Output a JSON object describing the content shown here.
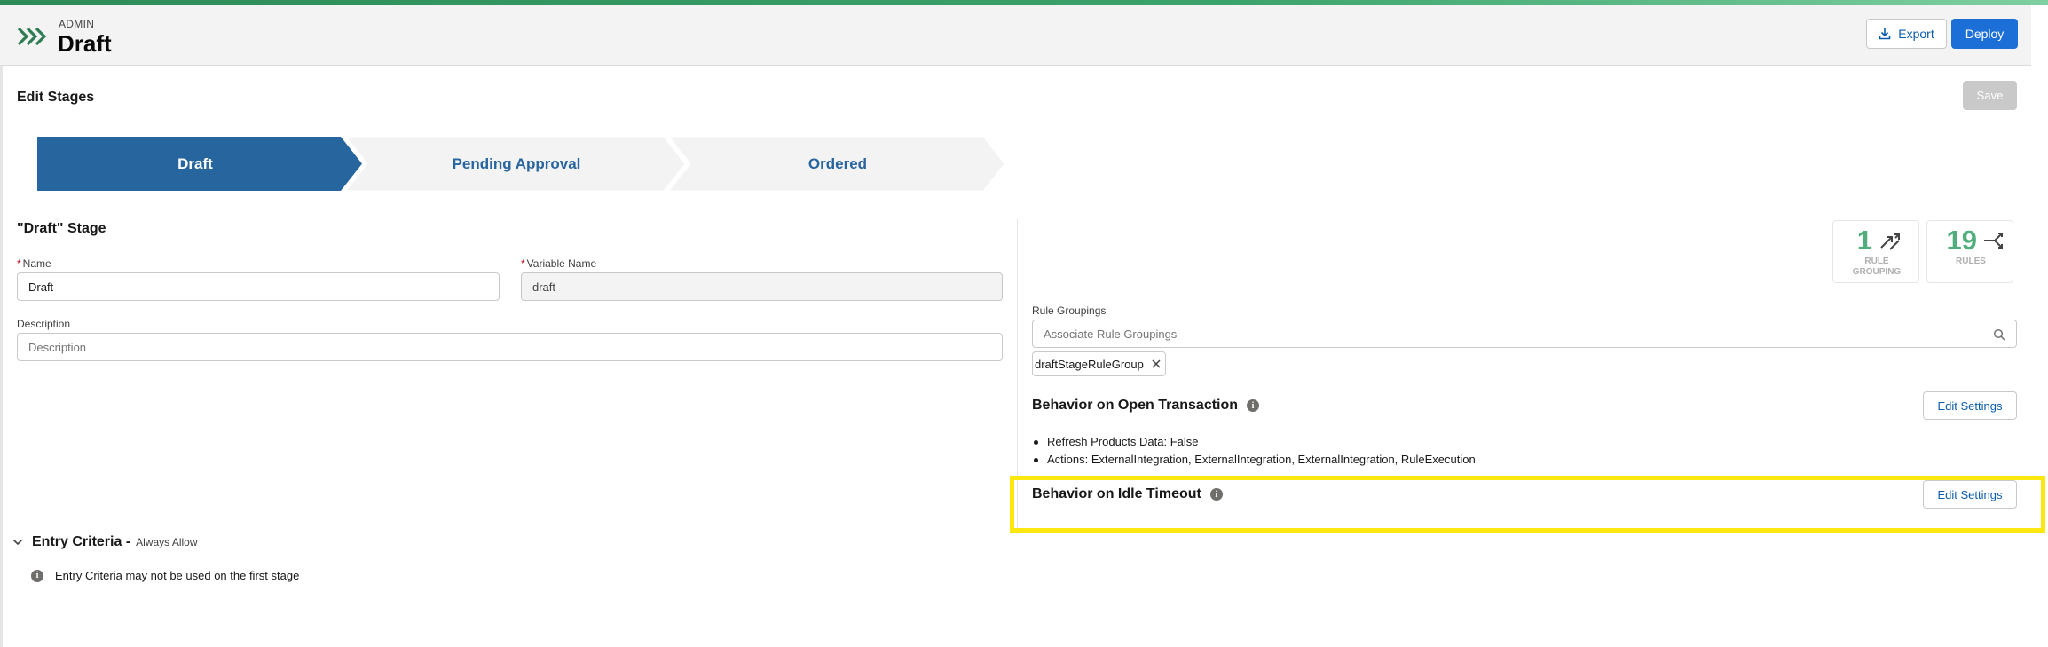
{
  "header": {
    "eyebrow": "ADMIN",
    "title": "Draft",
    "export_label": "Export",
    "deploy_label": "Deploy"
  },
  "page": {
    "heading": "Edit Stages",
    "save_label": "Save"
  },
  "path": {
    "stages": [
      {
        "label": "Draft",
        "active": true
      },
      {
        "label": "Pending Approval",
        "active": false
      },
      {
        "label": "Ordered",
        "active": false
      }
    ]
  },
  "stage_form": {
    "heading": "\"Draft\" Stage",
    "name_label": "Name",
    "name_value": "Draft",
    "variable_label": "Variable Name",
    "variable_value": "draft",
    "description_label": "Description",
    "description_placeholder": "Description"
  },
  "stats": {
    "rule_grouping_count": "1",
    "rule_grouping_label": "RULE GROUPING",
    "rules_count": "19",
    "rules_label": "RULES"
  },
  "rule_groupings": {
    "label": "Rule Groupings",
    "placeholder": "Associate Rule Groupings",
    "pill": "draftStageRuleGroup"
  },
  "open_transaction": {
    "heading": "Behavior on Open Transaction",
    "edit_label": "Edit Settings",
    "items": [
      "Refresh Products Data: False",
      "Actions: ExternalIntegration, ExternalIntegration, ExternalIntegration, RuleExecution"
    ]
  },
  "idle_timeout": {
    "heading": "Behavior on Idle Timeout",
    "edit_label": "Edit Settings"
  },
  "entry_criteria": {
    "heading": "Entry Criteria -",
    "subtitle": "Always Allow",
    "note": "Entry Criteria may not be used on the first stage"
  },
  "colors": {
    "brand": "#1b6fd6",
    "path_active": "#27659e",
    "stat_number": "#4fae7c",
    "highlight": "#fde711"
  }
}
